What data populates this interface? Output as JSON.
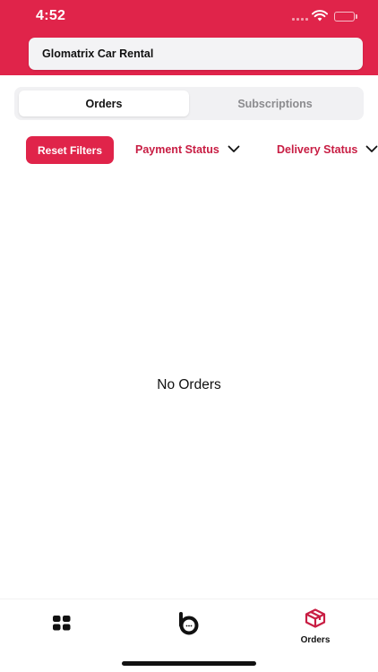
{
  "status_bar": {
    "time": "4:52"
  },
  "header": {
    "store_name": "Glomatrix Car Rental"
  },
  "segments": {
    "orders_label": "Orders",
    "subscriptions_label": "Subscriptions",
    "selected": "Orders"
  },
  "filters": {
    "reset_label": "Reset Filters",
    "payment_label": "Payment Status",
    "delivery_label": "Delivery Status"
  },
  "empty_state": {
    "message": "No Orders"
  },
  "tab_bar": {
    "items": [
      {
        "icon": "grid-icon",
        "label": ""
      },
      {
        "icon": "brand-logo-icon",
        "label": ""
      },
      {
        "icon": "package-box-icon",
        "label": "Orders"
      }
    ],
    "active": "Orders"
  },
  "colors": {
    "brand": "#e0244a",
    "accent_text": "#c81d43",
    "muted_text": "#8b8b8e"
  }
}
